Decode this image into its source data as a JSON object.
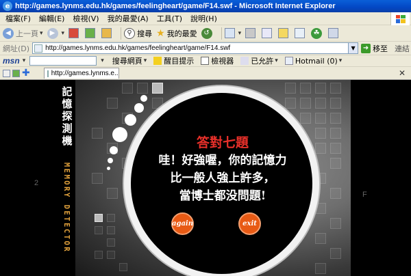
{
  "window": {
    "title": "http://games.lynms.edu.hk/games/feelingheart/game/F14.swf - Microsoft Internet Explorer"
  },
  "menu": [
    "檔案(F)",
    "編輯(E)",
    "檢視(V)",
    "我的最愛(A)",
    "工具(T)",
    "說明(H)"
  ],
  "toolbar": {
    "back_label": "上一頁",
    "search_label": "搜尋",
    "favorites_label": "我的最愛"
  },
  "address": {
    "label": "網址(D)",
    "url": "http://games.lynms.edu.hk/games/feelingheart/game/F14.swf",
    "go_label": "移至",
    "links_label": "連結"
  },
  "msn": {
    "logo": "msn",
    "search_web": "搜尋網頁",
    "highlight": "醒目提示",
    "viewer": "檢視器",
    "allowed": "已允許",
    "hotmail": "Hotmail (0)"
  },
  "tab": {
    "label": "http://games.lynms.e..."
  },
  "game": {
    "vertical_title": [
      "記",
      "憶",
      "探",
      "測",
      "機"
    ],
    "vertical_subtitle": "MEMORY DETECTOR",
    "left_number": "2",
    "right_letter": "F",
    "result_title": "答對七題",
    "message_line1": "哇！好強喔，你的記憶力",
    "message_line2": "比一般人強上許多，",
    "message_line3": "當博士都没問題!",
    "again_label": "again",
    "exit_label": "exit"
  },
  "colors": {
    "title_bar": "#0347c4",
    "result_title": "#e8302a",
    "subtitle": "#e2a23c",
    "button": "#e85a14"
  }
}
